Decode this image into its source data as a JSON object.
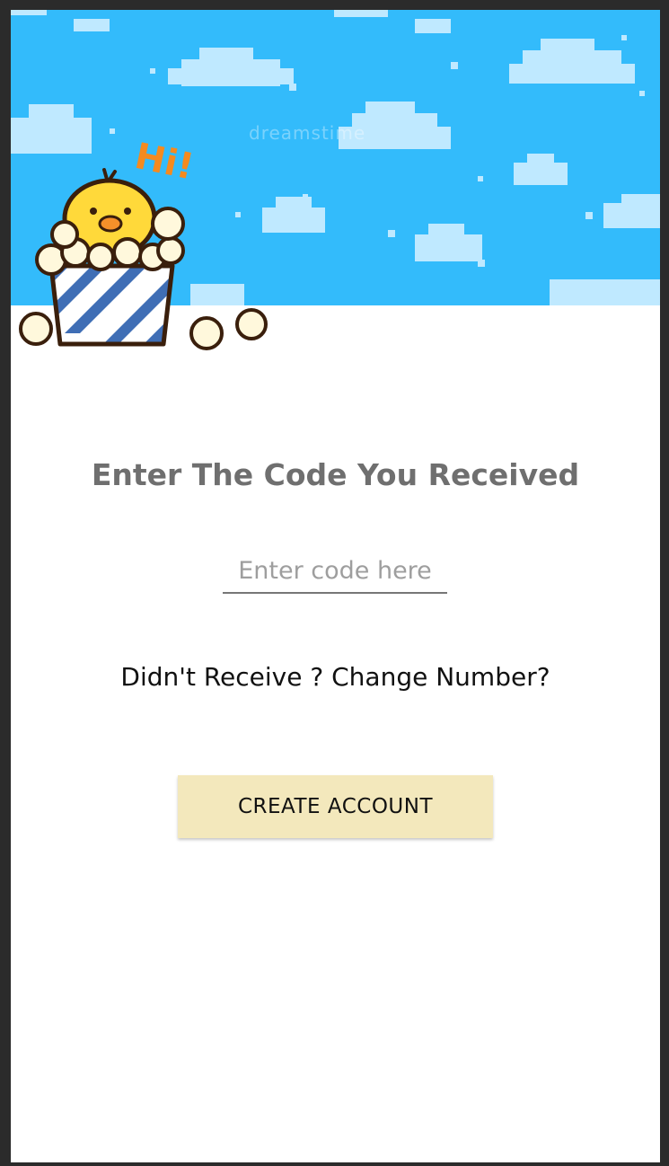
{
  "banner": {
    "sky_color": "#33bbfb",
    "cloud_color": "#bfe9ff",
    "watermark": "dreamstime",
    "greeting": "Hi!",
    "greeting_color": "#f58a1f",
    "mascot": "chick-in-popcorn-bucket"
  },
  "form": {
    "title": "Enter The Code You Received",
    "code_placeholder": "Enter code here",
    "code_value": "",
    "resend_link": "Didn't Receive ? Change Number?",
    "create_button": "CREATE ACCOUNT",
    "button_color": "#f3e8bc"
  }
}
